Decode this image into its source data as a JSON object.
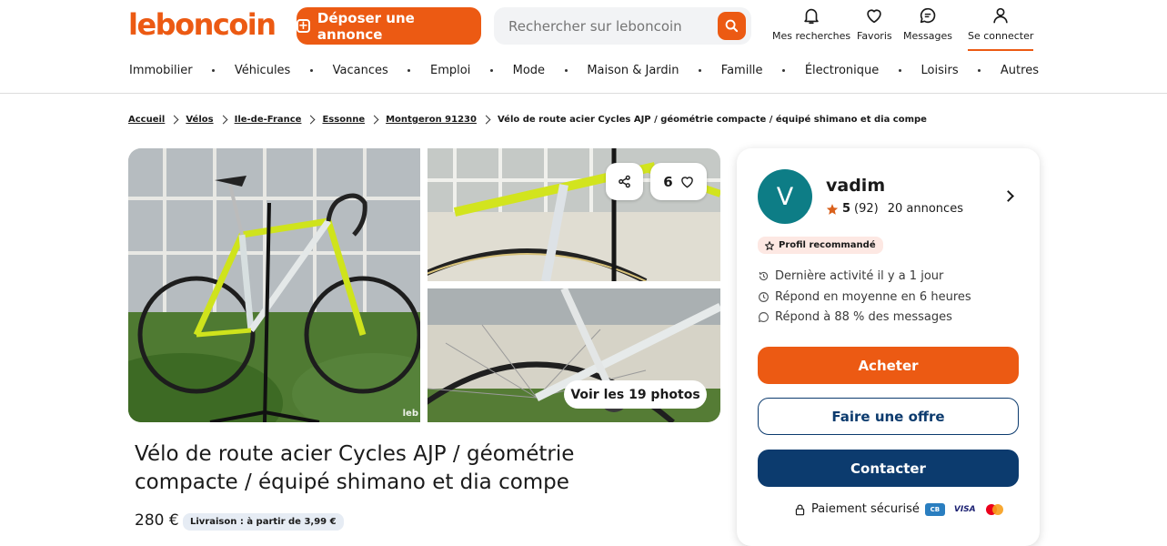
{
  "header": {
    "logo": "leboncoin",
    "post_button": "Déposer une annonce",
    "search_placeholder": "Rechercher sur leboncoin",
    "nav": {
      "searches": "Mes recherches",
      "favorites": "Favoris",
      "messages": "Messages",
      "login": "Se connecter"
    },
    "categories": [
      "Immobilier",
      "Véhicules",
      "Vacances",
      "Emploi",
      "Mode",
      "Maison & Jardin",
      "Famille",
      "Électronique",
      "Loisirs",
      "Autres"
    ]
  },
  "breadcrumb": [
    "Accueil",
    "Vélos",
    "Ile-de-France",
    "Essonne",
    "Montgeron 91230",
    "Vélo de route acier Cycles AJP / géométrie compacte / équipé shimano et dia compe"
  ],
  "gallery": {
    "watermark": "leb",
    "favorites_count": "6",
    "photos_button": "Voir les 19 photos"
  },
  "ad": {
    "title": "Vélo de route acier Cycles AJP / géométrie compacte / équipé shimano et dia compe",
    "price": "280 €",
    "delivery": "Livraison : à partir de 3,99 €"
  },
  "seller": {
    "initial": "V",
    "name": "vadim",
    "rating": "5",
    "reviews": "(92)",
    "ads_count": "20 annonces",
    "badge": "Profil recommandé",
    "last_activity": "Dernière activité il y a 1 jour",
    "response_time": "Répond en moyenne en 6 heures",
    "response_rate": "Répond à 88 % des messages"
  },
  "actions": {
    "buy": "Acheter",
    "offer": "Faire une offre",
    "contact": "Contacter",
    "secure_payment": "Paiement sécurisé",
    "cb": "CB",
    "visa": "VISA"
  },
  "colors": {
    "brand_orange": "#ec5a13",
    "navy": "#0c3b6e",
    "avatar_teal": "#0d7d86"
  }
}
